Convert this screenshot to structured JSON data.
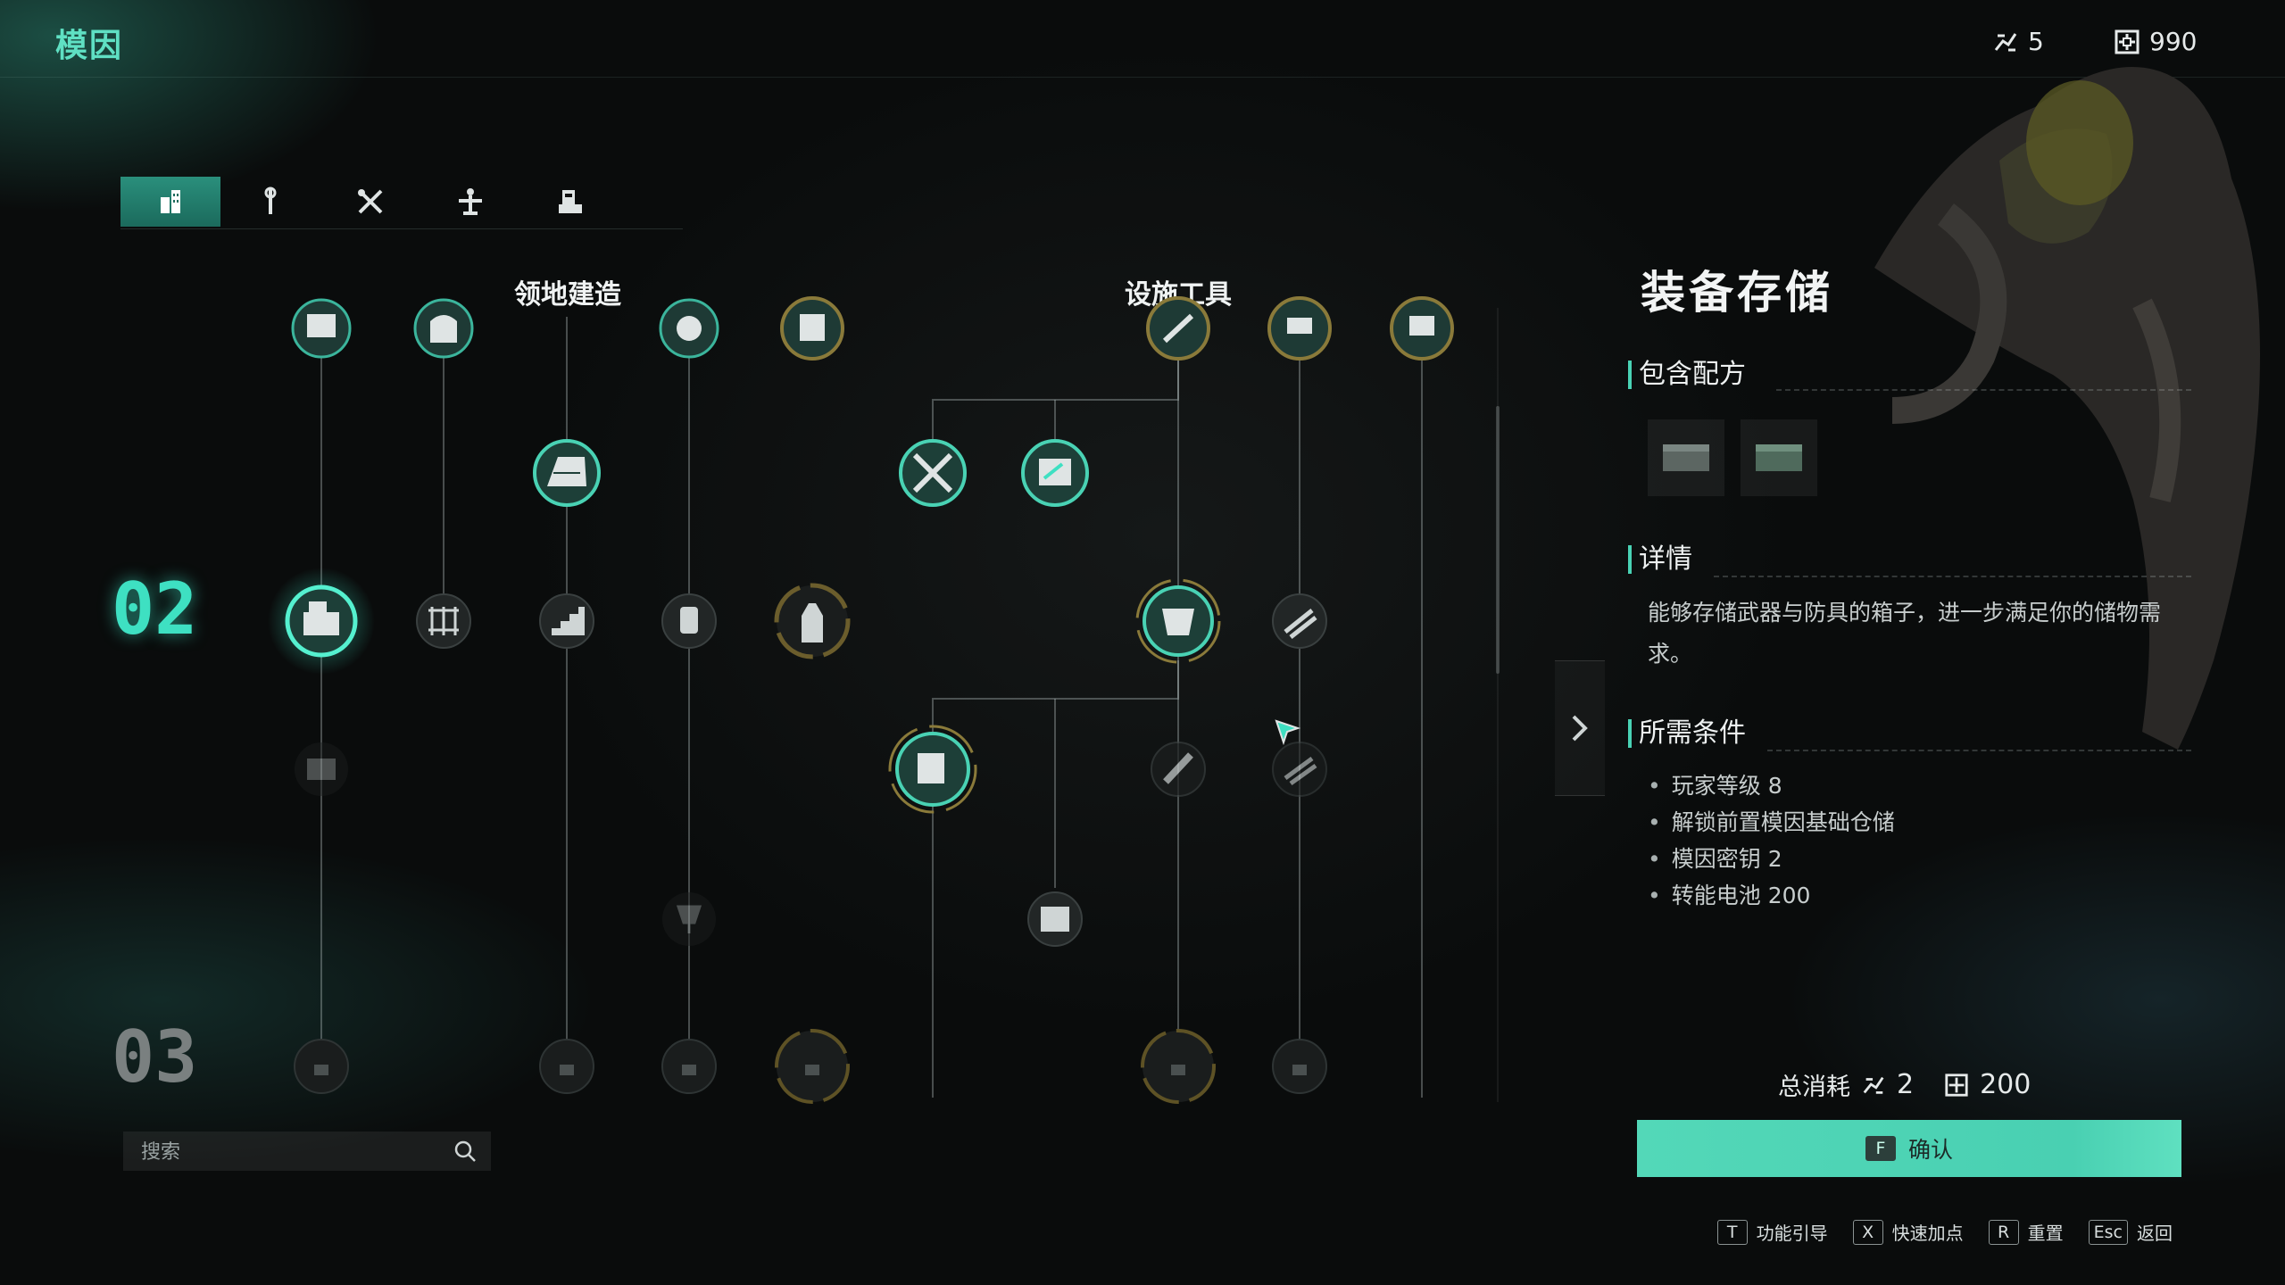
{
  "app_title": "模因",
  "currency": {
    "points": "5",
    "energy": "990"
  },
  "tabs": [
    {
      "icon": "building-icon",
      "active": true
    },
    {
      "icon": "wrench-icon",
      "active": false
    },
    {
      "icon": "crossed-tools-icon",
      "active": false
    },
    {
      "icon": "workbench-icon",
      "active": false
    },
    {
      "icon": "structure-icon",
      "active": false
    }
  ],
  "columns": {
    "territory": "领地建造",
    "facility": "设施工具"
  },
  "tiers": {
    "current": "02",
    "next": "03"
  },
  "search": {
    "placeholder": "搜索"
  },
  "detail": {
    "title": "装备存储",
    "recipes_label": "包含配方",
    "details_label": "详情",
    "description": "能够存储武器与防具的箱子，进一步满足你的储物需求。",
    "requirements_label": "所需条件",
    "requirements": [
      "玩家等级 8",
      "解锁前置模因基础仓储",
      "模因密钥 2",
      "转能电池 200"
    ]
  },
  "cost": {
    "label": "总消耗",
    "points": "2",
    "energy": "200"
  },
  "confirm": {
    "key": "F",
    "label": "确认"
  },
  "hints": [
    {
      "key": "T",
      "label": "功能引导"
    },
    {
      "key": "X",
      "label": "快速加点"
    },
    {
      "key": "R",
      "label": "重置"
    },
    {
      "key": "Esc",
      "label": "返回"
    }
  ],
  "colors": {
    "accent": "#49d2b4",
    "tier_active": "#3ee0c2",
    "gold_ring": "#8a7a3a"
  }
}
